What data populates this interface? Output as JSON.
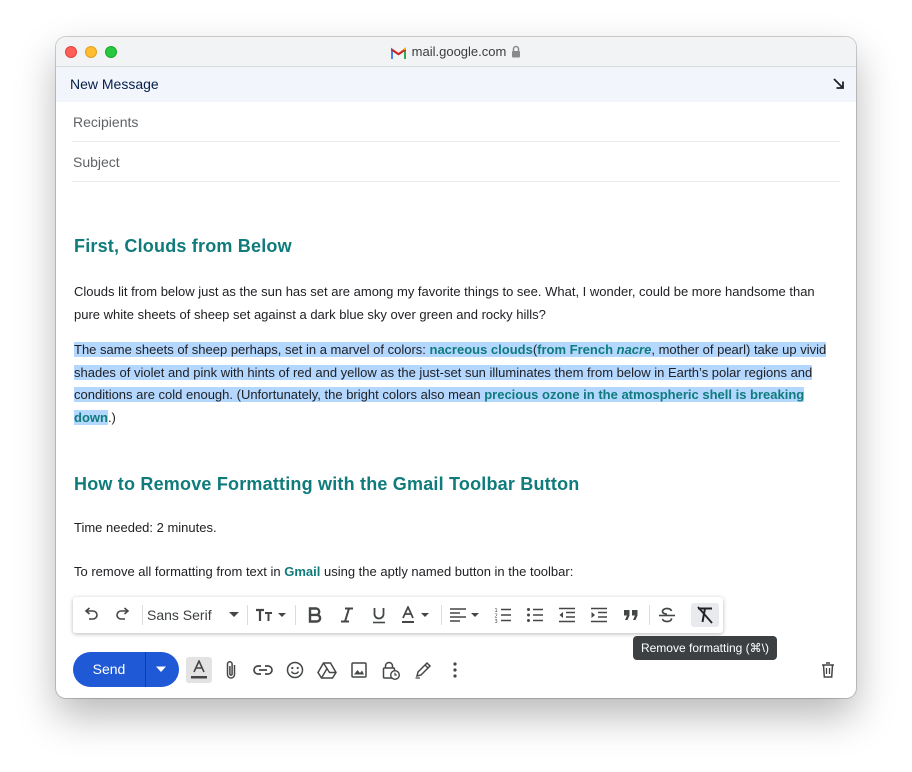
{
  "browser": {
    "url": "mail.google.com"
  },
  "compose": {
    "title": "New Message",
    "recipients_placeholder": "Recipients",
    "subject_placeholder": "Subject"
  },
  "content": {
    "heading1": "First, Clouds from Below",
    "para1": "Clouds lit from below just as the sun has set are among my favorite things to see. What, I wonder, could be more handsome than pure white sheets of sheep set against a dark blue sky over green and rocky hills?",
    "para2": {
      "a": "The same sheets of sheep perhaps, set in a marvel of colors: ",
      "b": "nacreous clouds",
      "c": "(",
      "d": "from French ",
      "e": "nacre",
      "f": ", mother of pearl) take up vivid shades of violet and pink with hints of red and yellow as the just-set sun illuminates them from below in Earth’s polar regions and conditions are cold enough. (Unfortunately, the bright colors also mean ",
      "g": "precious ozone in the atmospheric shell is breaking down",
      "h": ".)"
    },
    "heading2": "How to Remove Formatting with the Gmail Toolbar Button",
    "para3": "Time needed: 2 minutes.",
    "para4": {
      "a": "To remove all formatting from text in ",
      "b": "Gmail",
      "c": " using the aptly named button in the toolbar:"
    }
  },
  "toolbar": {
    "font_name": "Sans Serif",
    "tooltip": "Remove formatting (⌘\\)"
  },
  "actions": {
    "send_label": "Send"
  },
  "colors": {
    "accent": "#0f7b7b",
    "send": "#1f59d6",
    "selection": "#b3d7ff"
  }
}
